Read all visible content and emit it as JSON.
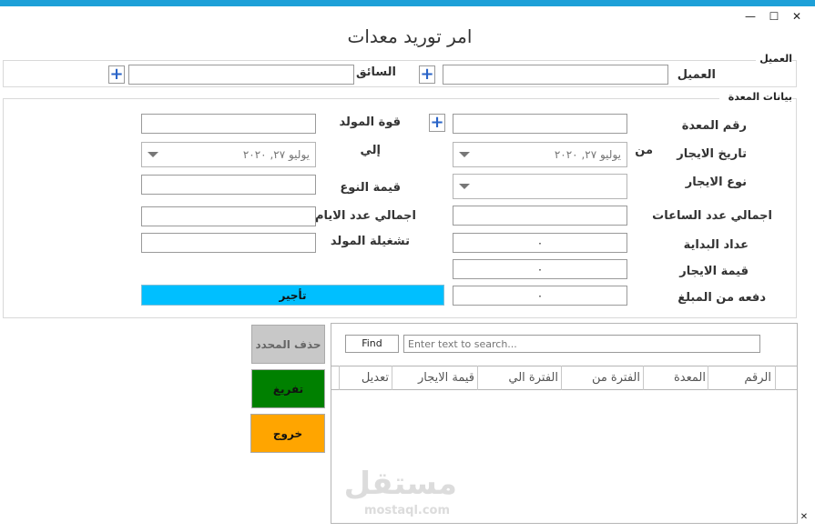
{
  "window": {
    "title": "امر توريد معدات",
    "minimize_glyph": "—",
    "maximize_glyph": "☐",
    "close_glyph": "✕"
  },
  "customer_group": {
    "caption": "العميل",
    "customer_label": "العميل",
    "customer_value": "",
    "driver_label": "السائق",
    "driver_value": "",
    "add_glyph": "+"
  },
  "equipment_group": {
    "caption": "بيانات المعدة",
    "add_glyph": "+",
    "equipment_no_label": "رقم المعدة",
    "equipment_no_value": "",
    "generator_power_label": "قوة المولد",
    "generator_power_value": "",
    "rent_date_label": "تاريخ الايجار",
    "from_label": "من",
    "from_date": "يوليو ٢٧, ٢٠٢٠",
    "to_label": "إلي",
    "to_date": "يوليو ٢٧, ٢٠٢٠",
    "rent_type_label": "نوع الايجار",
    "rent_type_value": "",
    "type_value_label": "قيمة النوع",
    "type_value_value": "",
    "total_hours_label": "اجمالي عدد الساعات",
    "total_hours_value": "",
    "total_days_label": "اجمالي عدد الايام",
    "total_days_value": "",
    "start_meter_label": "عداد البداية",
    "start_meter_value": "٠",
    "generator_run_label": "تشغيلة المولد",
    "generator_run_value": "",
    "rent_value_label": "قيمة الايجار",
    "rent_value_value": "٠",
    "payment_label": "دفعه من المبلغ",
    "payment_value": "٠",
    "rent_button": "تأجير"
  },
  "actions": {
    "delete_selected": "حذف المحدد",
    "clear": "تفريغ",
    "exit": "خروج"
  },
  "grid": {
    "find_button": "Find",
    "search_placeholder": "Enter text to search...",
    "columns": [
      "الرقم",
      "المعدة",
      "الفترة من",
      "الفترة الي",
      "قيمة الايجار",
      "تعديل"
    ]
  },
  "watermark": {
    "arabic": "مستقل",
    "latin": "mostaql.com"
  },
  "colors": {
    "accent_bar": "#1ea0d8",
    "rent_button_bg": "#00bfff",
    "clear_button_bg": "#008000",
    "exit_button_bg": "#ffa500",
    "delete_button_bg": "#c8c8c8"
  }
}
